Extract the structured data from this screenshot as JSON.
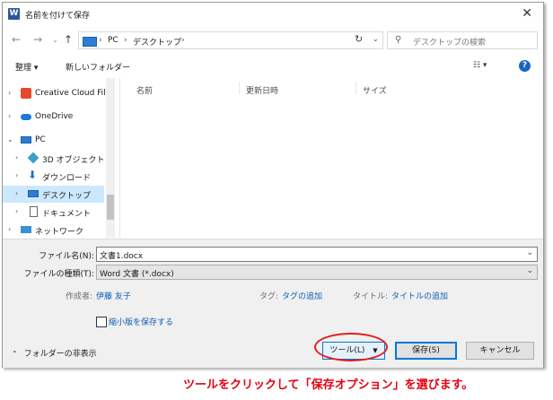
{
  "window": {
    "title": "名前を付けて保存",
    "app_icon": "W"
  },
  "nav": {
    "breadcrumb": [
      "PC",
      "デスクトップ"
    ],
    "search_placeholder": "デスクトップの検索"
  },
  "toolbar": {
    "organize": "整理 ▾",
    "new_folder": "新しいフォルダー"
  },
  "sidebar": {
    "items": [
      {
        "label": "Creative Cloud Files"
      },
      {
        "label": "OneDrive"
      },
      {
        "label": "PC"
      },
      {
        "label": "3D オブジェクト"
      },
      {
        "label": "ダウンロード"
      },
      {
        "label": "デスクトップ"
      },
      {
        "label": "ドキュメント"
      },
      {
        "label": "ネットワーク"
      }
    ]
  },
  "columns": [
    "名前",
    "更新日時",
    "サイズ"
  ],
  "form": {
    "filename_label": "ファイル名(N):",
    "filename_value": "文書1.docx",
    "filetype_label": "ファイルの種類(T):",
    "filetype_value": "Word 文書 (*.docx)",
    "author_label": "作成者:",
    "author_value": "伊藤 友子",
    "tags_label": "タグ:",
    "tags_value": "タグの追加",
    "title_label": "タイトル:",
    "title_value": "タイトルの追加",
    "thumbnail_label": "縮小版を保存する"
  },
  "footer": {
    "hide_folders": "フォルダーの非表示",
    "tools": "ツール(L)",
    "save": "保存(S)",
    "cancel": "キャンセル"
  },
  "caption": "ツールをクリックして「保存オプション」を選びます。",
  "colors": {
    "accent": "#0078d7",
    "highlight": "#e60012",
    "selected": "#cce8ff"
  }
}
